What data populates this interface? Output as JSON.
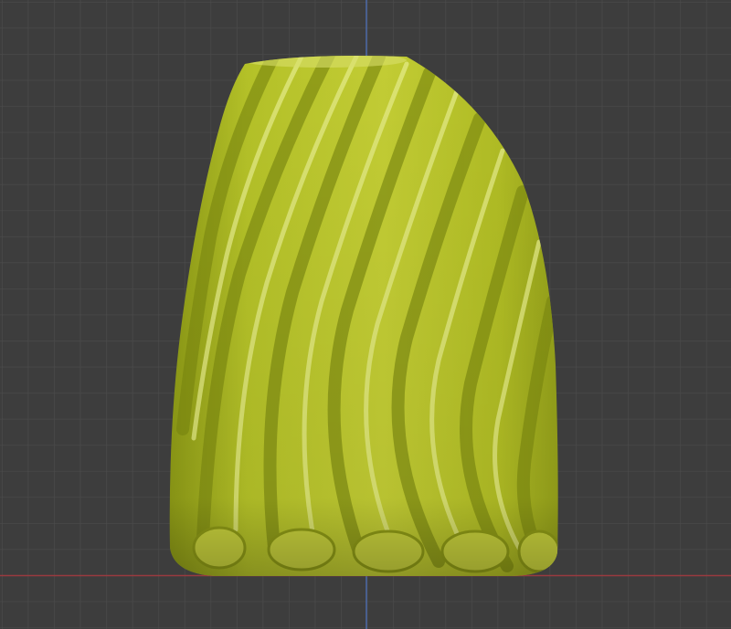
{
  "viewport": {
    "background_color": "#3d3d3d",
    "grid_color": "#4a4a4a",
    "x_axis_color": "#9a3a3f",
    "z_axis_color": "#4d6aa8",
    "object": {
      "name_icon": "twisted-vase-mesh",
      "base_color": "#b5c02a",
      "highlight_color": "#e6ec8c",
      "shadow_color": "#6e7a10"
    }
  }
}
